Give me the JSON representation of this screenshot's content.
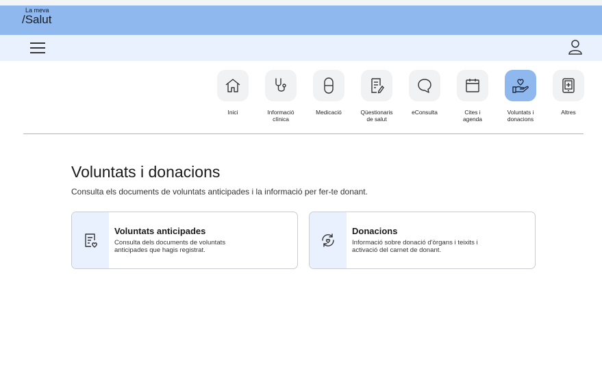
{
  "header": {
    "logo_small": "La meva",
    "logo_big": "/Salut"
  },
  "nav": {
    "tiles": [
      {
        "line1": "Inici",
        "line2": "",
        "icon": "home-icon"
      },
      {
        "line1": "Informació",
        "line2": "clínica",
        "icon": "stethoscope-icon"
      },
      {
        "line1": "Medicació",
        "line2": "",
        "icon": "pill-icon"
      },
      {
        "line1": "Qüestionaris",
        "line2": "de salut",
        "icon": "questionnaire-icon"
      },
      {
        "line1": "eConsulta",
        "line2": "",
        "icon": "chat-bubble-icon"
      },
      {
        "line1": "Cites i",
        "line2": "agenda",
        "icon": "calendar-icon"
      },
      {
        "line1": "Voluntats i",
        "line2": "donacions",
        "icon": "hand-heart-icon",
        "active": true
      },
      {
        "line1": "Altres",
        "line2": "",
        "icon": "tablet-plus-icon"
      }
    ]
  },
  "main": {
    "title": "Voluntats i donacions",
    "subtitle": "Consulta els documents de voluntats anticipades i la informació per fer-te donant."
  },
  "cards": [
    {
      "title": "Voluntats anticipades",
      "desc_line1": "Consulta dels documents de voluntats",
      "desc_line2": "anticipades que hagis registrat.",
      "icon": "document-heart-icon"
    },
    {
      "title": "Donacions",
      "desc_line1": "Informació sobre donació d'òrgans i teixits i",
      "desc_line2": "activació del carnet de donant.",
      "icon": "heart-cycle-icon"
    }
  ],
  "colors": {
    "brand_bar": "#8fb8ee",
    "nav_bar": "#e8f1fd",
    "active_tile": "#8fb8ee"
  }
}
